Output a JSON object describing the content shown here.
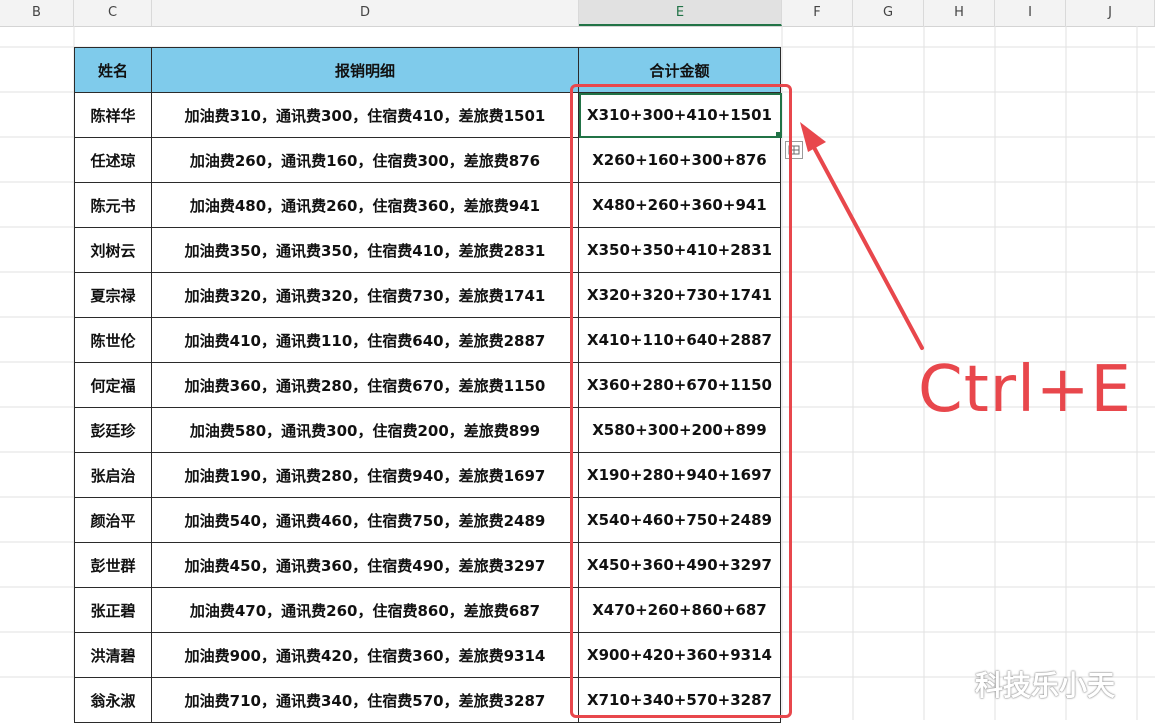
{
  "columns": [
    "B",
    "C",
    "D",
    "E",
    "F",
    "G",
    "H",
    "I",
    "J"
  ],
  "table": {
    "headers": [
      "姓名",
      "报销明细",
      "合计金额"
    ],
    "rows": [
      [
        "陈祥华",
        "加油费310，通讯费300，住宿费410，差旅费1501",
        "X310+300+410+1501"
      ],
      [
        "任述琼",
        "加油费260，通讯费160，住宿费300，差旅费876",
        "X260+160+300+876"
      ],
      [
        "陈元书",
        "加油费480，通讯费260，住宿费360，差旅费941",
        "X480+260+360+941"
      ],
      [
        "刘树云",
        "加油费350，通讯费350，住宿费410，差旅费2831",
        "X350+350+410+2831"
      ],
      [
        "夏宗禄",
        "加油费320，通讯费320，住宿费730，差旅费1741",
        "X320+320+730+1741"
      ],
      [
        "陈世伦",
        "加油费410，通讯费110，住宿费640，差旅费2887",
        "X410+110+640+2887"
      ],
      [
        "何定福",
        "加油费360，通讯费280，住宿费670，差旅费1150",
        "X360+280+670+1150"
      ],
      [
        "彭廷珍",
        "加油费580，通讯费300，住宿费200，差旅费899",
        "X580+300+200+899"
      ],
      [
        "张启治",
        "加油费190，通讯费280，住宿费940，差旅费1697",
        "X190+280+940+1697"
      ],
      [
        "颜治平",
        "加油费540，通讯费460，住宿费750，差旅费2489",
        "X540+460+750+2489"
      ],
      [
        "彭世群",
        "加油费450，通讯费360，住宿费490，差旅费3297",
        "X450+360+490+3297"
      ],
      [
        "张正碧",
        "加油费470，通讯费260，住宿费860，差旅费687",
        "X470+260+860+687"
      ],
      [
        "洪清碧",
        "加油费900，通讯费420，住宿费360，差旅费9314",
        "X900+420+360+9314"
      ],
      [
        "翁永淑",
        "加油费710，通讯费340，住宿费570，差旅费3287",
        "X710+340+570+3287"
      ]
    ]
  },
  "annotation": {
    "shortcut": "Ctrl+E",
    "color": "#e8474c"
  },
  "watermark": "科技乐小天",
  "colors": {
    "header_fill": "#7fcbeb",
    "selection": "#217346"
  }
}
